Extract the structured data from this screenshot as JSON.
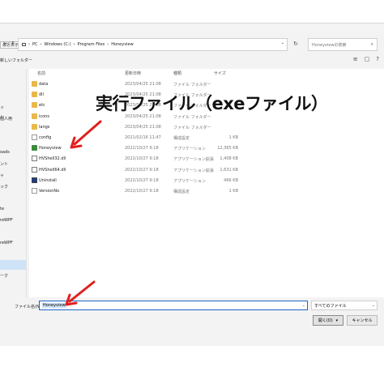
{
  "overlay_caption": "実行ファイル（exeファイル）",
  "nav": {
    "back": "←",
    "forward": "↑"
  },
  "address": {
    "segments": [
      "PC",
      "Windows (C:)",
      "Program Files",
      "Honeyview"
    ],
    "separator": "›",
    "dropdown": "⌄"
  },
  "search": {
    "placeholder": "Honeyviewの検索",
    "icon": "search-icon"
  },
  "refresh": "↻",
  "tooltip": "最近表示された場所",
  "toolbar": {
    "new_folder": "新しいフォルダー",
    "view_icon": "≡",
    "pane_icon": "▢",
    "help_icon": "?"
  },
  "sidebar": {
    "items": [
      "ッ",
      "レ",
      "個人用",
      "",
      "oads",
      "ント",
      "",
      "ャ",
      "ック",
      "",
      "te",
      "",
      "reWPF",
      "",
      "reWPF",
      "",
      "",
      "",
      "",
      "ーク"
    ]
  },
  "columns": {
    "name": "名前",
    "date": "更新日時",
    "type": "種類",
    "size": "サイズ"
  },
  "files": [
    {
      "name": "data",
      "date": "2023/04/25 21:08",
      "type": "ファイル フォルダー",
      "size": "",
      "kind": "folder"
    },
    {
      "name": "dll",
      "date": "2023/04/25 21:08",
      "type": "ファイル フォルダー",
      "size": "",
      "kind": "folder"
    },
    {
      "name": "etc",
      "date": "2023/04/25 21:08",
      "type": "ファイル フォルダー",
      "size": "",
      "kind": "folder"
    },
    {
      "name": "icons",
      "date": "2023/04/25 21:08",
      "type": "ファイル フォルダー",
      "size": "",
      "kind": "folder"
    },
    {
      "name": "langs",
      "date": "2023/04/25 21:08",
      "type": "ファイル フォルダー",
      "size": "",
      "kind": "folder"
    },
    {
      "name": "config",
      "date": "2021/02/16 11:47",
      "type": "構成設定",
      "size": "1 KB",
      "kind": "file"
    },
    {
      "name": "Honeyview",
      "date": "2022/10/27 9:18",
      "type": "アプリケーション",
      "size": "12,365 KB",
      "kind": "app"
    },
    {
      "name": "HVShell32.dll",
      "date": "2022/10/27 9:18",
      "type": "アプリケーション拡張",
      "size": "1,408 KB",
      "kind": "dll"
    },
    {
      "name": "HVShell64.dll",
      "date": "2022/10/27 9:18",
      "type": "アプリケーション拡張",
      "size": "1,631 KB",
      "kind": "dll"
    },
    {
      "name": "Uninstall",
      "date": "2022/10/27 9:18",
      "type": "アプリケーション",
      "size": "466 KB",
      "kind": "exe"
    },
    {
      "name": "VersionNo",
      "date": "2022/10/27 9:18",
      "type": "構成設定",
      "size": "1 KB",
      "kind": "file"
    }
  ],
  "bottom": {
    "filename_label": "ファイル名(N):",
    "filename_value": "Honeyview",
    "filename_dropdown": "⌄",
    "filetype_value": "すべてのファイル",
    "filetype_dropdown": "⌄",
    "open_label": "開く(O)",
    "open_dropdown": "▾",
    "cancel_label": "キャンセル"
  },
  "colors": {
    "arrow": "#e0201f",
    "selection": "#cfe3f7",
    "folder": "#e8b94a"
  }
}
